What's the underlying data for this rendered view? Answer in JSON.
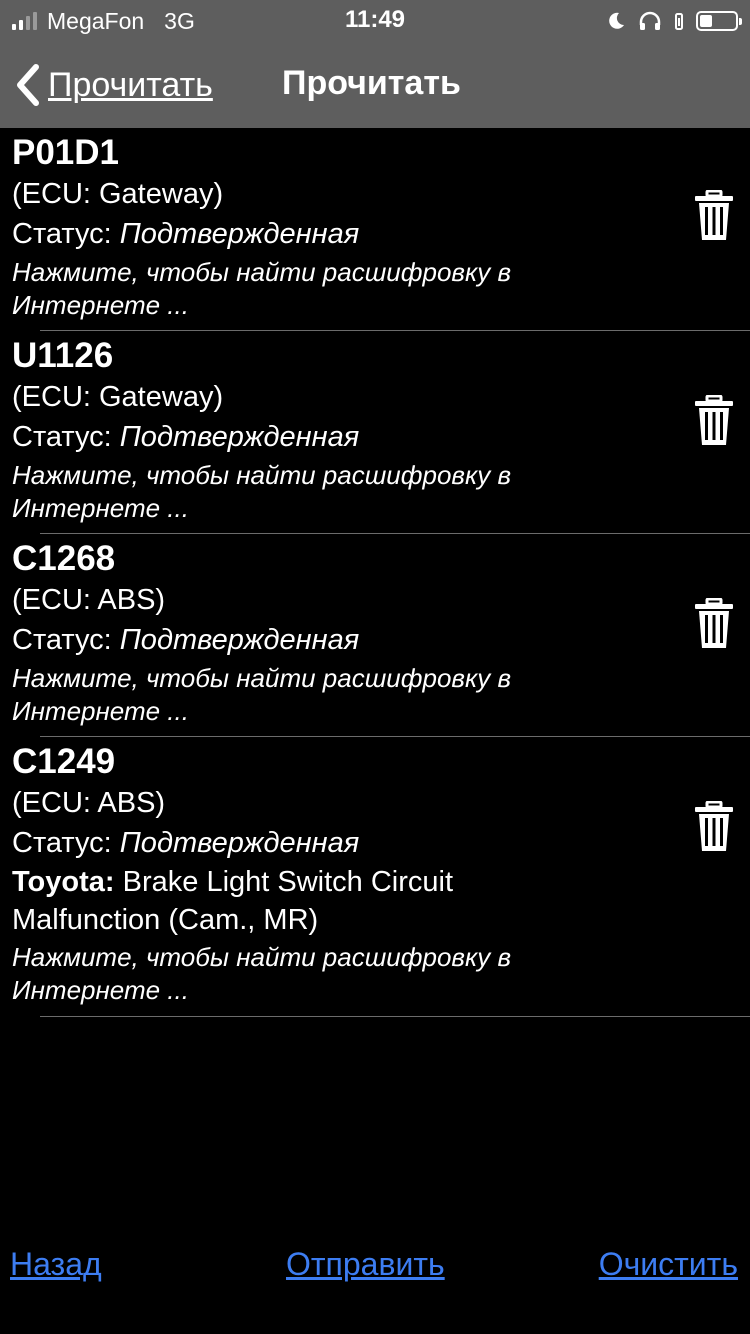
{
  "status_bar": {
    "carrier": "MegaFon",
    "network": "3G",
    "time": "11:49",
    "signal_bars_active": 2,
    "signal_bars_total": 4
  },
  "nav": {
    "back_label": "Прочитать",
    "title": "Прочитать"
  },
  "codes": [
    {
      "code": "P01D1",
      "ecu": "(ECU: Gateway)",
      "status_label": "Статус:",
      "status_value": "Подтвержденная",
      "hint_line1": "Нажмите, чтобы найти расшифровку в",
      "hint_line2": "Интернете ..."
    },
    {
      "code": "U1126",
      "ecu": "(ECU: Gateway)",
      "status_label": "Статус:",
      "status_value": "Подтвержденная",
      "hint_line1": "Нажмите, чтобы найти расшифровку в",
      "hint_line2": "Интернете ..."
    },
    {
      "code": "C1268",
      "ecu": "(ECU: ABS)",
      "status_label": "Статус:",
      "status_value": "Подтвержденная",
      "hint_line1": "Нажмите, чтобы найти расшифровку в",
      "hint_line2": "Интернете ..."
    },
    {
      "code": "C1249",
      "ecu": "(ECU: ABS)",
      "status_label": "Статус:",
      "status_value": "Подтвержденная",
      "maker_label": "Toyota:",
      "description_line1": "Brake Light Switch Circuit",
      "description_line2": "Malfunction (Cam., MR)",
      "hint_line1": "Нажмите, чтобы найти расшифровку в",
      "hint_line2": "Интернете ..."
    }
  ],
  "toolbar": {
    "back_label": "Назад",
    "send_label": "Отправить",
    "clear_label": "Очистить"
  },
  "colors": {
    "nav_background": "#5e5e5e",
    "background": "#000000",
    "link": "#3d7df2",
    "separator": "#6b6b6b"
  }
}
